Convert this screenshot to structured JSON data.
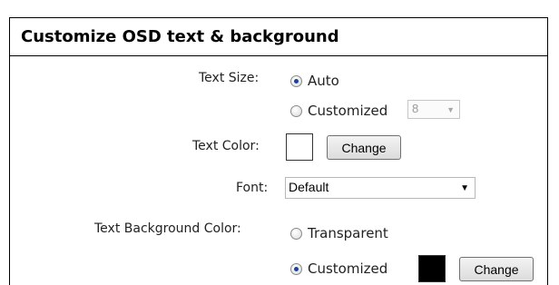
{
  "panel": {
    "title": "Customize OSD text & background"
  },
  "text_size": {
    "label": "Text Size:",
    "options": [
      {
        "label": "Auto",
        "checked": true
      },
      {
        "label": "Customized",
        "checked": false
      }
    ],
    "size_value": "8",
    "arrow_icon": "chevron-down-icon"
  },
  "text_color": {
    "label": "Text Color:",
    "swatch_color": "#ffffff",
    "change_label": "Change"
  },
  "font": {
    "label": "Font:",
    "value": "Default",
    "arrow_icon": "chevron-down-icon"
  },
  "text_background": {
    "label": "Text Background Color:",
    "options": [
      {
        "label": "Transparent",
        "checked": false
      },
      {
        "label": "Customized",
        "checked": true
      }
    ],
    "swatch_color": "#000000",
    "change_label": "Change"
  }
}
